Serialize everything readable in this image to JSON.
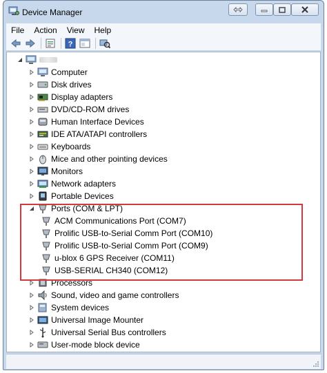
{
  "window": {
    "title": "Device Manager",
    "icon": "device-manager-icon",
    "caption_buttons": [
      "swap-icon",
      "minimize-icon",
      "maximize-icon",
      "close-icon"
    ]
  },
  "menu": [
    "File",
    "Action",
    "View",
    "Help"
  ],
  "toolbar": [
    "back-arrow-icon",
    "forward-arrow-icon",
    "properties-icon",
    "help-icon",
    "show-hide-pane-icon",
    "scan-hardware-icon"
  ],
  "tree": {
    "root_icon": "computer-icon",
    "categories": [
      {
        "label": "Computer",
        "icon": "computer-icon"
      },
      {
        "label": "Disk drives",
        "icon": "disk-drive-icon"
      },
      {
        "label": "Display adapters",
        "icon": "display-adapter-icon"
      },
      {
        "label": "DVD/CD-ROM drives",
        "icon": "dvd-drive-icon"
      },
      {
        "label": "Human Interface Devices",
        "icon": "hid-icon"
      },
      {
        "label": "IDE ATA/ATAPI controllers",
        "icon": "ide-controller-icon"
      },
      {
        "label": "Keyboards",
        "icon": "keyboard-icon"
      },
      {
        "label": "Mice and other pointing devices",
        "icon": "mouse-icon"
      },
      {
        "label": "Monitors",
        "icon": "monitor-icon"
      },
      {
        "label": "Network adapters",
        "icon": "network-adapter-icon"
      },
      {
        "label": "Portable Devices",
        "icon": "portable-device-icon"
      },
      {
        "label": "Ports (COM & LPT)",
        "icon": "port-icon",
        "expanded": true,
        "children": [
          "ACM Communications Port (COM7)",
          "Prolific USB-to-Serial Comm Port (COM10)",
          "Prolific USB-to-Serial Comm Port (COM9)",
          "u-blox 6 GPS Receiver (COM11)",
          "USB-SERIAL CH340 (COM12)"
        ]
      },
      {
        "label": "Processors",
        "icon": "processor-icon"
      },
      {
        "label": "Sound, video and game controllers",
        "icon": "sound-icon"
      },
      {
        "label": "System devices",
        "icon": "system-device-icon"
      },
      {
        "label": "Universal Image Mounter",
        "icon": "image-mounter-icon"
      },
      {
        "label": "Universal Serial Bus controllers",
        "icon": "usb-icon"
      },
      {
        "label": "User-mode block device",
        "icon": "block-device-icon"
      }
    ]
  },
  "colors": {
    "highlight_border": "#d03a3e",
    "window_frame": "#c7d8ec"
  }
}
